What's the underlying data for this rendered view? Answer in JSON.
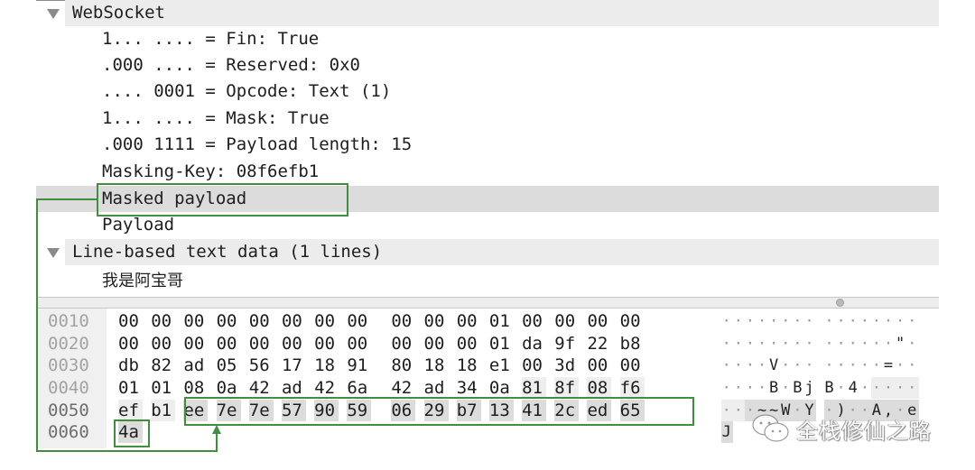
{
  "tree": {
    "rows": [
      {
        "text": "WebSocket",
        "kind": "header",
        "expanded": true
      },
      {
        "text": "1... .... = Fin: True",
        "kind": "field"
      },
      {
        "text": ".000 .... = Reserved: 0x0",
        "kind": "field"
      },
      {
        "text": ".... 0001 = Opcode: Text (1)",
        "kind": "field"
      },
      {
        "text": "1... .... = Mask: True",
        "kind": "field"
      },
      {
        "text": ".000 1111 = Payload length: 15",
        "kind": "field"
      },
      {
        "text": "Masking-Key: 08f6efb1",
        "kind": "field"
      },
      {
        "text": "Masked payload",
        "kind": "field",
        "selected": true
      },
      {
        "text": "Payload",
        "kind": "field"
      },
      {
        "text": "Line-based text data (1 lines)",
        "kind": "header",
        "expanded": true
      },
      {
        "text": "我是阿宝哥",
        "kind": "field"
      }
    ]
  },
  "hex": {
    "rows": [
      {
        "offset": "0010",
        "bytes": [
          "00",
          "00",
          "00",
          "00",
          "00",
          "00",
          "00",
          "00",
          "00",
          "00",
          "00",
          "01",
          "00",
          "00",
          "00",
          "00"
        ],
        "ascii": [
          "·",
          "·",
          "·",
          "·",
          "·",
          "·",
          "·",
          "·",
          "·",
          "·",
          "·",
          "·",
          "·",
          "·",
          "·",
          "·"
        ]
      },
      {
        "offset": "0020",
        "bytes": [
          "00",
          "00",
          "00",
          "00",
          "00",
          "00",
          "00",
          "00",
          "00",
          "00",
          "00",
          "01",
          "da",
          "9f",
          "22",
          "b8"
        ],
        "ascii": [
          "·",
          "·",
          "·",
          "·",
          "·",
          "·",
          "·",
          "·",
          "·",
          "·",
          "·",
          "·",
          "·",
          "·",
          "\"",
          "·"
        ]
      },
      {
        "offset": "0030",
        "bytes": [
          "db",
          "82",
          "ad",
          "05",
          "56",
          "17",
          "18",
          "91",
          "80",
          "18",
          "18",
          "e1",
          "00",
          "3d",
          "00",
          "00"
        ],
        "ascii": [
          "·",
          "·",
          "·",
          "·",
          "V",
          "·",
          "·",
          "·",
          "·",
          "·",
          "·",
          "·",
          "·",
          "=",
          "·",
          "·"
        ]
      },
      {
        "offset": "0040",
        "bytes": [
          "01",
          "01",
          "08",
          "0a",
          "42",
          "ad",
          "42",
          "6a",
          "42",
          "ad",
          "34",
          "0a",
          "81",
          "8f",
          "08",
          "f6"
        ],
        "ascii": [
          "·",
          "·",
          "·",
          "·",
          "B",
          "·",
          "B",
          "j",
          "B",
          "·",
          "4",
          "·",
          "·",
          "·",
          "·",
          "·"
        ]
      },
      {
        "offset": "0050",
        "bytes": [
          "ef",
          "b1",
          "ee",
          "7e",
          "7e",
          "57",
          "90",
          "59",
          "06",
          "29",
          "b7",
          "13",
          "41",
          "2c",
          "ed",
          "65"
        ],
        "ascii": [
          "·",
          "·",
          "·",
          "~",
          "~",
          "W",
          "·",
          "Y",
          "·",
          ")",
          "·",
          "·",
          "A",
          ",",
          "·",
          "e"
        ]
      },
      {
        "offset": "0060",
        "bytes": [
          "4a"
        ],
        "ascii": [
          "J"
        ]
      }
    ],
    "frame_header_bytes": [
      [
        3,
        12
      ],
      [
        3,
        13
      ],
      [
        3,
        14
      ],
      [
        3,
        15
      ],
      [
        4,
        0
      ],
      [
        4,
        1
      ]
    ],
    "masked_payload_bytes": [
      [
        4,
        2
      ],
      [
        4,
        3
      ],
      [
        4,
        4
      ],
      [
        4,
        5
      ],
      [
        4,
        6
      ],
      [
        4,
        7
      ],
      [
        4,
        8
      ],
      [
        4,
        9
      ],
      [
        4,
        10
      ],
      [
        4,
        11
      ],
      [
        4,
        12
      ],
      [
        4,
        13
      ],
      [
        4,
        14
      ],
      [
        4,
        15
      ],
      [
        5,
        0
      ]
    ]
  },
  "annotation": {
    "color": "#3f8f3f",
    "label": "Masked payload → highlighted bytes"
  },
  "watermark": {
    "icon": "wechat-icon",
    "text": "全栈修仙之路"
  }
}
